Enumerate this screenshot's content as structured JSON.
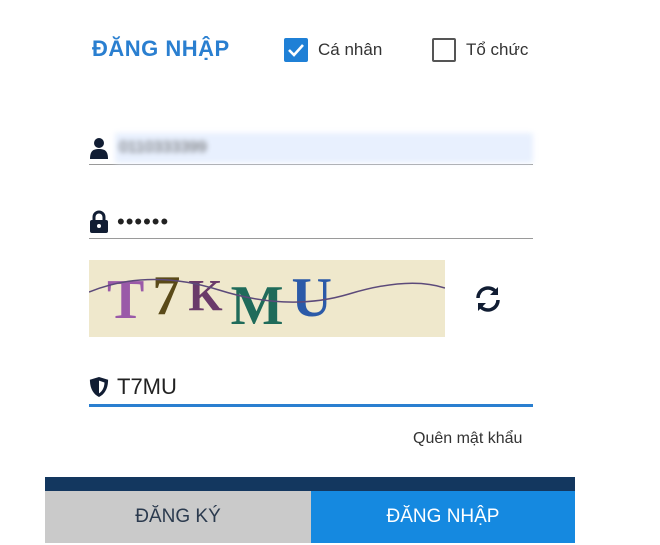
{
  "form": {
    "title": "ĐĂNG NHẬP",
    "account_type": {
      "personal": {
        "label": "Cá nhân",
        "checked": true
      },
      "organization": {
        "label": "Tổ chức",
        "checked": false
      }
    },
    "username": {
      "value": "0110333399",
      "icon": "user-icon",
      "redacted": true
    },
    "password": {
      "value": "••••••",
      "icon": "lock-icon"
    },
    "captcha": {
      "image_text": "T7KMU",
      "refresh_icon": "refresh-icon"
    },
    "captcha_input": {
      "value": "T7MU",
      "icon": "shield-icon"
    },
    "forgot_password": "Quên mật khẩu"
  },
  "buttons": {
    "register": "ĐĂNG KÝ",
    "login": "ĐĂNG NHẬP"
  },
  "colors": {
    "accent": "#2a7fd0",
    "login_button": "#1589e0",
    "register_button": "#cacaca",
    "captcha_bg": "#efe8cc"
  }
}
